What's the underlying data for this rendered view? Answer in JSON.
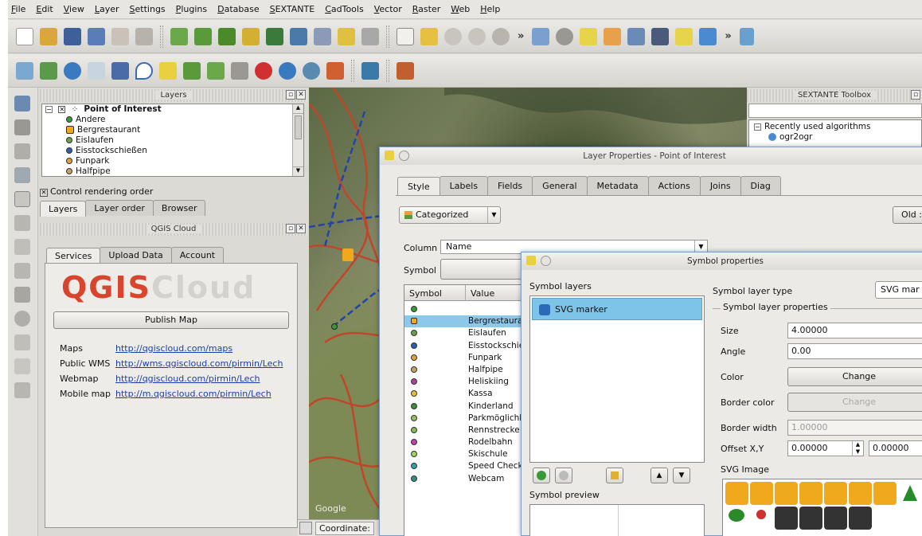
{
  "menubar": [
    "File",
    "Edit",
    "View",
    "Layer",
    "Settings",
    "Plugins",
    "Database",
    "SEXTANTE",
    "CadTools",
    "Vector",
    "Raster",
    "Web",
    "Help"
  ],
  "layers_panel": {
    "title": "Layers",
    "group": "Point of Interest",
    "items": [
      {
        "label": "Andere",
        "color": "#3a9a3a"
      },
      {
        "label": "Bergrestaurant",
        "color": "#f0a81c"
      },
      {
        "label": "Eislaufen",
        "color": "#6aa04a"
      },
      {
        "label": "Eisstockschießen",
        "color": "#2a5fb0"
      },
      {
        "label": "Funpark",
        "color": "#e0a040"
      },
      {
        "label": "Halfpipe",
        "color": "#c8a060"
      }
    ],
    "control_rendering": "Control rendering order",
    "tabs": [
      "Layers",
      "Layer order",
      "Browser"
    ]
  },
  "qgis_cloud": {
    "title": "QGIS Cloud",
    "tabs": [
      "Services",
      "Upload Data",
      "Account"
    ],
    "logo_q": "QGIS",
    "logo_cloud": "Cloud",
    "publish": "Publish Map",
    "links": [
      {
        "label": "Maps",
        "url": "http://qgiscloud.com/maps"
      },
      {
        "label": "Public WMS",
        "url": "http://wms.qgiscloud.com/pirmin/Lech"
      },
      {
        "label": "Webmap",
        "url": "http://qgiscloud.com/pirmin/Lech"
      },
      {
        "label": "Mobile map",
        "url": "http://m.qgiscloud.com/pirmin/Lech"
      }
    ]
  },
  "map": {
    "google": "Google",
    "coordinate": "Coordinate:"
  },
  "sextante": {
    "title": "SEXTANTE Toolbox",
    "recent": "Recently used algorithms",
    "algo": "ogr2ogr"
  },
  "layer_props": {
    "title": "Layer Properties - Point of Interest",
    "tabs": [
      "Style",
      "Labels",
      "Fields",
      "General",
      "Metadata",
      "Actions",
      "Joins",
      "Diag"
    ],
    "renderer": "Categorized",
    "old": "Old :",
    "column_label": "Column",
    "column_value": "Name",
    "symbol_label": "Symbol",
    "table_headers": [
      "Symbol",
      "Value"
    ],
    "rows": [
      {
        "v": "",
        "c": "#3a9a3a"
      },
      {
        "v": "Bergrestaurant",
        "c": "#f0a81c"
      },
      {
        "v": "Eislaufen",
        "c": "#6aa04a"
      },
      {
        "v": "Eisstockschießen",
        "c": "#2a5fb0"
      },
      {
        "v": "Funpark",
        "c": "#e0a040"
      },
      {
        "v": "Halfpipe",
        "c": "#c8a060"
      },
      {
        "v": "Heliskiing",
        "c": "#b040a0"
      },
      {
        "v": "Kassa",
        "c": "#e8c030"
      },
      {
        "v": "Kinderland",
        "c": "#3a8a3a"
      },
      {
        "v": "Parkmöglichkeit",
        "c": "#90c060"
      },
      {
        "v": "Rennstrecke",
        "c": "#80c050"
      },
      {
        "v": "Rodelbahn",
        "c": "#c040b0"
      },
      {
        "v": "Skischule",
        "c": "#a0d060"
      },
      {
        "v": "Speed Check",
        "c": "#30a0a0"
      },
      {
        "v": "Webcam",
        "c": "#309080"
      }
    ]
  },
  "symbol_props": {
    "title": "Symbol properties",
    "symbol_layers": "Symbol layers",
    "layer_item": "SVG marker",
    "symbol_preview": "Symbol preview",
    "type_label": "Symbol layer type",
    "type_value": "SVG mar",
    "group_label": "Symbol layer properties",
    "size_label": "Size",
    "size_value": "4.00000",
    "angle_label": "Angle",
    "angle_value": "0.00",
    "color_label": "Color",
    "change": "Change",
    "border_color_label": "Border color",
    "border_width_label": "Border width",
    "border_width_value": "1.00000",
    "offset_label": "Offset X,Y",
    "offset_x": "0.00000",
    "offset_y": "0.00000",
    "svg_image_label": "SVG Image"
  }
}
